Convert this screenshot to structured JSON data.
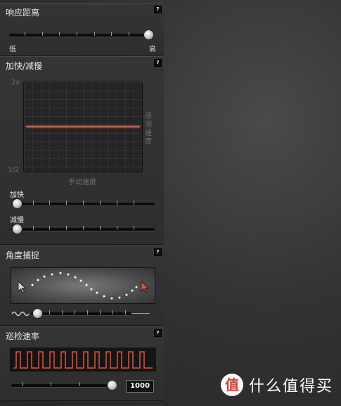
{
  "response_distance": {
    "title": "响应距离",
    "help": "?",
    "min_label": "低",
    "max_label": "高",
    "value": 1.0
  },
  "accel_decel": {
    "title": "加快/减慢",
    "help": "?",
    "graph": {
      "y_top": "2x",
      "y_bottom": "1/2",
      "y_side": "感测速度",
      "x_label": "手动速度"
    },
    "accel_label": "加快",
    "accel_value": 0.0,
    "decel_label": "减慢",
    "decel_value": 0.0
  },
  "angle_snap": {
    "title": "角度捕捉",
    "help": "?",
    "value": 0.2
  },
  "patrol_rate": {
    "title": "巡检速率",
    "help": "?",
    "value": "1000",
    "slider_value": 1.0
  },
  "brand": {
    "badge": "值",
    "text": "什么值得买"
  },
  "colors": {
    "accent": "#e0553a",
    "panel": "#333333"
  }
}
